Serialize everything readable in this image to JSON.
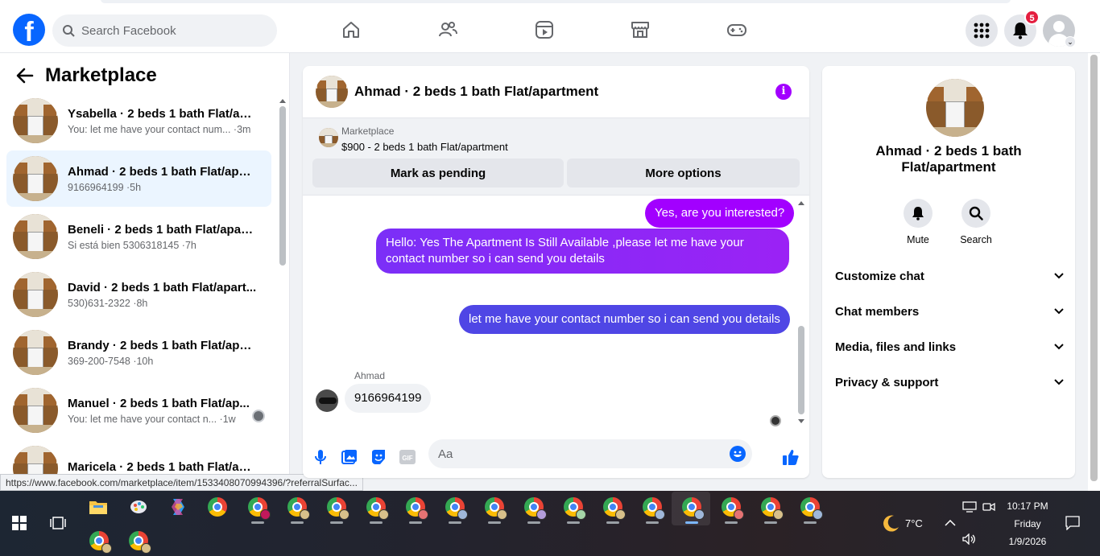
{
  "topbar": {
    "logo": "f",
    "search_placeholder": "Search Facebook",
    "notification_count": "5"
  },
  "sidebar": {
    "title": "Marketplace",
    "conversations": [
      {
        "name": "Ysabella · 2 beds 1 bath Flat/apa...",
        "preview": "You: let me have your contact num... ·3m"
      },
      {
        "name": "Ahmad · 2 beds 1 bath Flat/apar...",
        "preview": "9166964199 ·5h"
      },
      {
        "name": "Beneli · 2 beds 1 bath Flat/apart...",
        "preview": "Si está bien 5306318145 ·7h"
      },
      {
        "name": "David · 2 beds 1 bath Flat/apart...",
        "preview": "530)631-2322 ·8h"
      },
      {
        "name": "Brandy · 2 beds 1 bath Flat/apart...",
        "preview": "369-200-7548 ·10h"
      },
      {
        "name": "Manuel · 2 beds 1 bath Flat/ap...",
        "preview": "You: let me have your contact n... ·1w"
      },
      {
        "name": "Maricela · 2 beds 1 bath Flat/apa...",
        "preview": ""
      }
    ]
  },
  "status_url": "https://www.facebook.com/marketplace/item/1533408070994396/?referralSurfac...",
  "chat": {
    "title": "Ahmad · 2 beds 1 bath Flat/apartment",
    "listing_label": "Marketplace",
    "listing_price": "$900 - 2 beds 1 bath Flat/apartment",
    "mark_pending": "Mark as pending",
    "more_options": "More options",
    "messages": [
      {
        "text": "Yes, are you interested?"
      },
      {
        "text": "Hello: Yes The Apartment Is Still Available ,please let me have your contact number so i can send you details"
      },
      {
        "text": "let me have your contact number so i can send you details"
      },
      {
        "text": "9166964199"
      }
    ],
    "sender_name": "Ahmad",
    "composer_placeholder": "Aa",
    "gif_label": "GIF"
  },
  "info_panel": {
    "name": "Ahmad · 2 beds 1 bath Flat/apartment",
    "mute_label": "Mute",
    "search_label": "Search",
    "sections": [
      "Customize chat",
      "Chat members",
      "Media, files and links",
      "Privacy & support"
    ]
  },
  "taskbar": {
    "weather": "7°C",
    "time": "10:17 PM",
    "day": "Friday",
    "date": "1/9/2026"
  },
  "colors": {
    "facebook_blue": "#0866ff",
    "message_purple": "#a200ff",
    "message_blue": "#4f46e5",
    "notification_red": "#e41e3f"
  }
}
